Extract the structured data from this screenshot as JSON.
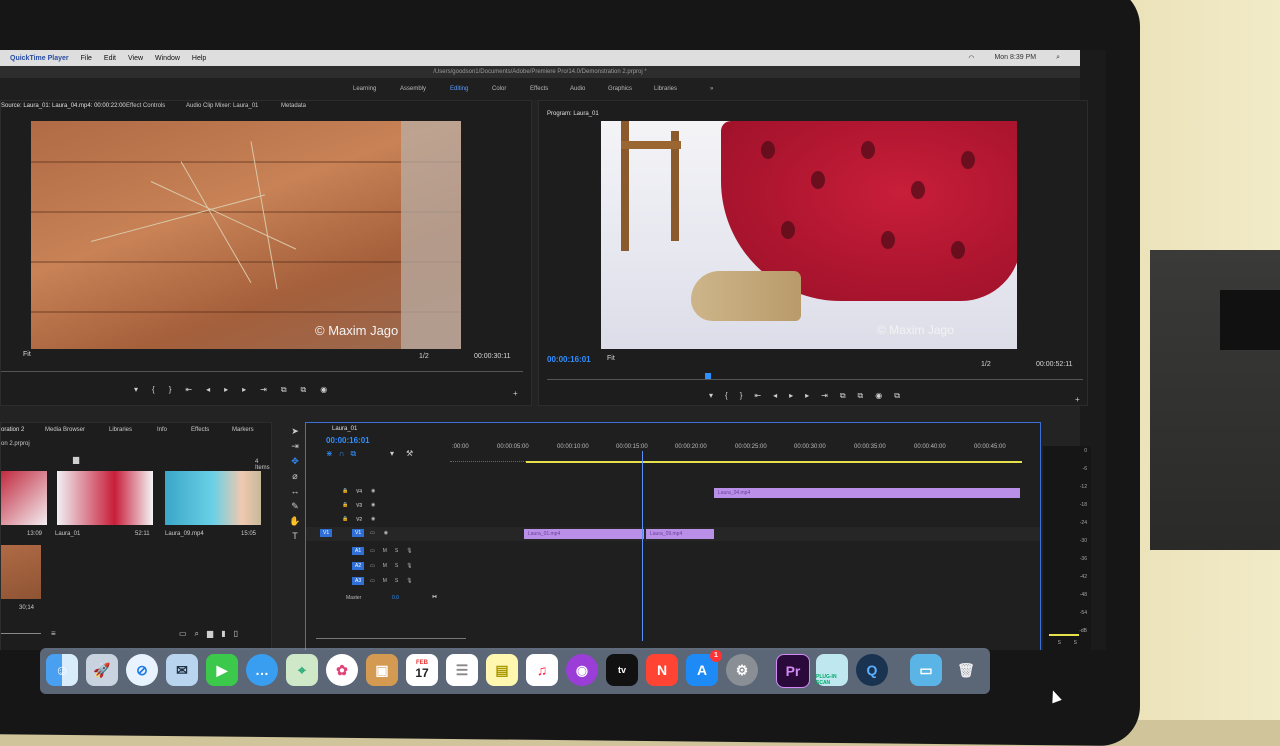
{
  "menubar": {
    "app": "QuickTime Player",
    "items": [
      "File",
      "Edit",
      "View",
      "Window",
      "Help"
    ],
    "clock": "Mon 8:39 PM"
  },
  "window": {
    "path": "/Users/goodson1/Documents/Adobe/Premiere Pro/14.0/Demonstration 2.prproj *"
  },
  "workspaces": [
    "Learning",
    "Assembly",
    "Editing",
    "Color",
    "Effects",
    "Audio",
    "Graphics",
    "Libraries"
  ],
  "active_workspace": "Editing",
  "source": {
    "tabs": [
      "Source: Laura_01: Laura_04.mp4: 00:00:22:00",
      "Effect Controls",
      "Audio Clip Mixer: Laura_01",
      "Metadata"
    ],
    "fit": "Fit",
    "resolution": "1/2",
    "duration": "00:00:30:11",
    "watermark": "© Maxim Jago"
  },
  "program": {
    "tab": "Program: Laura_01",
    "timecode": "00:00:16:01",
    "fit": "Fit",
    "resolution": "1/2",
    "duration": "00:00:52:11",
    "watermark": "© Maxim Jago"
  },
  "project": {
    "tabs": [
      "oration 2",
      "Media Browser",
      "Libraries",
      "Info",
      "Effects",
      "Markers"
    ],
    "file": "on 2.prproj",
    "count": "4 Items",
    "items": [
      {
        "name": "",
        "duration": "13:09"
      },
      {
        "name": "Laura_01",
        "duration": "52:11"
      },
      {
        "name": "Laura_09.mp4",
        "duration": "15:05"
      },
      {
        "name": "",
        "duration": "30;14"
      }
    ]
  },
  "timeline": {
    "tab": "Laura_01",
    "timecode": "00:00:16:01",
    "ruler": [
      ":00:00",
      "00:00:05:00",
      "00:00:10:00",
      "00:00:15:00",
      "00:00:20:00",
      "00:00:25:00",
      "00:00:30:00",
      "00:00:35:00",
      "00:00:40:00",
      "00:00:45:00"
    ],
    "video_tracks": [
      "V4",
      "V3",
      "V2",
      "V1"
    ],
    "audio_tracks": [
      "A1",
      "A2",
      "A3"
    ],
    "master": "Master",
    "master_value": "0.0",
    "clips": [
      "Laura_04.mp4",
      "Laura_01.mp4",
      "Laura_09.mp4"
    ]
  },
  "meter": {
    "db": [
      "0",
      "-6",
      "-12",
      "-18",
      "-24",
      "-30",
      "-36",
      "-42",
      "-48",
      "-54",
      "-dB"
    ],
    "solo": [
      "S",
      "S"
    ]
  },
  "dock": {
    "calendar_month": "FEB",
    "calendar_day": "17",
    "premiere_label": "Pr",
    "appstore_badge": "1",
    "scan_label": "PLUG-IN SCAN"
  }
}
